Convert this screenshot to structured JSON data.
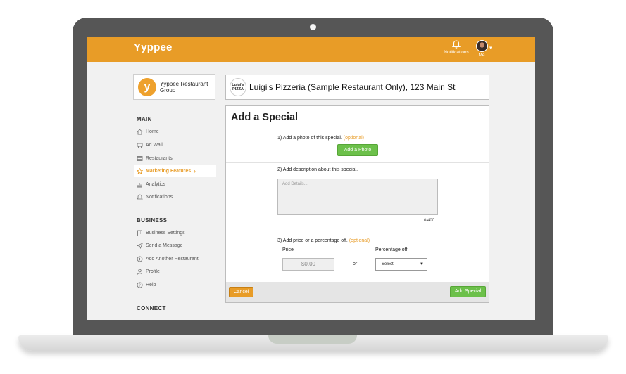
{
  "header": {
    "brand": "Yyppee",
    "notifications_label": "Notifications",
    "me_label": "Me"
  },
  "sidebar": {
    "org": {
      "logo_letter": "y",
      "name": "Yyppee Restaurant Group"
    },
    "sections": {
      "main": "MAIN",
      "business": "BUSINESS",
      "connect": "CONNECT"
    },
    "main_items": [
      {
        "label": "Home",
        "icon": "home-icon"
      },
      {
        "label": "Ad Wall",
        "icon": "ad-wall-icon"
      },
      {
        "label": "Restaurants",
        "icon": "restaurant-icon"
      },
      {
        "label": "Marketing Features",
        "icon": "star-icon",
        "active": true
      },
      {
        "label": "Analytics",
        "icon": "chart-icon"
      },
      {
        "label": "Notifications",
        "icon": "bell-icon"
      }
    ],
    "business_items": [
      {
        "label": "Business Settings",
        "icon": "building-icon"
      },
      {
        "label": "Send a Message",
        "icon": "send-icon"
      },
      {
        "label": "Add Another Restaurant",
        "icon": "plus-circle-icon"
      },
      {
        "label": "Profile",
        "icon": "user-icon"
      },
      {
        "label": "Help",
        "icon": "help-icon"
      }
    ]
  },
  "restaurant": {
    "logo_text": "Luigi's PIZZA",
    "name": "Luigi's Pizzeria (Sample Restaurant Only), 123 Main St"
  },
  "special_form": {
    "title": "Add a Special",
    "step1": {
      "text": "1) Add a photo of this special.",
      "optional": "(optional)",
      "button": "Add a Photo"
    },
    "step2": {
      "text": "2) Add description about this special.",
      "placeholder": "Add Details....",
      "counter": "0/400"
    },
    "step3": {
      "text": "3) Add price or a percentage off.",
      "optional": "(optional)",
      "price_label": "Price",
      "price_value": "$0.00",
      "or": "or",
      "percentage_label": "Percentage off",
      "select_value": "--Select--"
    },
    "cancel_button": "Cancel",
    "submit_button": "Add Special"
  },
  "colors": {
    "brand": "#e89c27",
    "success": "#6cc04a"
  }
}
